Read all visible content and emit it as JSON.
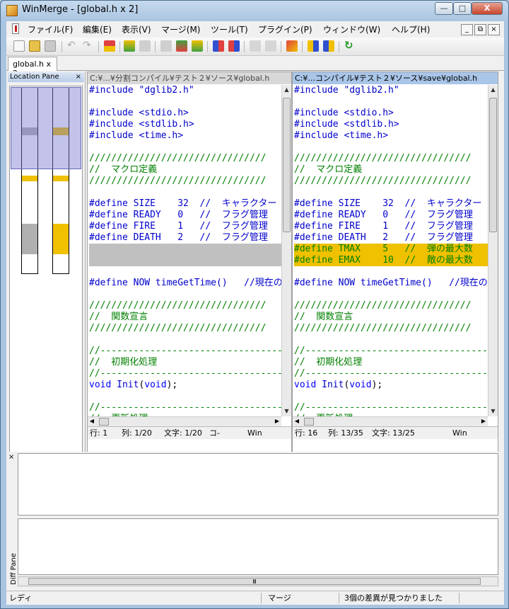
{
  "window": {
    "title": "WinMerge - [global.h x 2]",
    "min_icon": "minimize-icon",
    "max_icon": "maximize-icon",
    "close_icon": "close-icon",
    "close_glyph": "X"
  },
  "menu": {
    "items": [
      "ファイル(F)",
      "編集(E)",
      "表示(V)",
      "マージ(M)",
      "ツール(T)",
      "プラグイン(P)",
      "ウィンドウ(W)",
      "ヘルプ(H)"
    ]
  },
  "tab": {
    "label": "global.h x 2"
  },
  "location_pane": {
    "title": "Location Pane",
    "close": "×"
  },
  "left_pane": {
    "path": "C:¥...¥分割コンパイル¥テスト２¥ソース¥global.h",
    "status": {
      "line": "行: 1",
      "col": "列: 1/20",
      "char": "文字: 1/20",
      "cp": "コ-",
      "eol": "Win"
    }
  },
  "right_pane": {
    "path": "C:¥...コンパイル¥テスト２¥ソース¥save¥global.h",
    "status": {
      "line": "行: 16",
      "col": "列: 13/35",
      "char": "文字: 13/25",
      "eol": "Win"
    }
  },
  "code": {
    "left": [
      {
        "t": "#include \"dglib2.h\"",
        "c": "pp"
      },
      {
        "t": "",
        "c": "blk"
      },
      {
        "t": "#include <stdio.h>",
        "c": "pp"
      },
      {
        "t": "#include <stdlib.h>",
        "c": "pp"
      },
      {
        "t": "#include <time.h>",
        "c": "pp"
      },
      {
        "t": "",
        "c": "blk"
      },
      {
        "t": "////////////////////////////////",
        "c": ""
      },
      {
        "t": "//  マクロ定義",
        "c": ""
      },
      {
        "t": "////////////////////////////////",
        "c": ""
      },
      {
        "t": "",
        "c": "blk"
      },
      {
        "t": "#define SIZE    32  //  キャラクター",
        "c": "pp"
      },
      {
        "t": "#define READY   0   //  フラグ管理",
        "c": "pp"
      },
      {
        "t": "#define FIRE    1   //  フラグ管理",
        "c": "pp"
      },
      {
        "t": "#define DEATH   2   //  フラグ管理",
        "c": "pp"
      },
      {
        "t": "",
        "c": "gap"
      },
      {
        "t": "",
        "c": "gap"
      },
      {
        "t": "",
        "c": "blk"
      },
      {
        "t": "#define NOW timeGetTime()   //現在の",
        "c": "pp"
      },
      {
        "t": "",
        "c": "blk"
      },
      {
        "t": "////////////////////////////////",
        "c": ""
      },
      {
        "t": "//  関数宣言",
        "c": ""
      },
      {
        "t": "////////////////////////////////",
        "c": ""
      },
      {
        "t": "",
        "c": "blk"
      },
      {
        "t": "//--------------------------------------",
        "c": ""
      },
      {
        "t": "//  初期化処理",
        "c": ""
      },
      {
        "t": "//--------------------------------------",
        "c": ""
      },
      {
        "t": "void Init(void);",
        "c": "fn"
      },
      {
        "t": "",
        "c": "blk"
      },
      {
        "t": "//--------------------------------------",
        "c": ""
      },
      {
        "t": "//  更新処理",
        "c": ""
      }
    ],
    "right": [
      {
        "t": "#include \"dglib2.h\"",
        "c": "pp"
      },
      {
        "t": "",
        "c": "blk"
      },
      {
        "t": "#include <stdio.h>",
        "c": "pp"
      },
      {
        "t": "#include <stdlib.h>",
        "c": "pp"
      },
      {
        "t": "#include <time.h>",
        "c": "pp"
      },
      {
        "t": "",
        "c": "blk"
      },
      {
        "t": "////////////////////////////////",
        "c": ""
      },
      {
        "t": "//  マクロ定義",
        "c": ""
      },
      {
        "t": "////////////////////////////////",
        "c": ""
      },
      {
        "t": "",
        "c": "blk"
      },
      {
        "t": "#define SIZE    32  //  キャラクター",
        "c": "pp"
      },
      {
        "t": "#define READY   0   //  フラグ管理",
        "c": "pp"
      },
      {
        "t": "#define FIRE    1   //  フラグ管理",
        "c": "pp"
      },
      {
        "t": "#define DEATH   2   //  フラグ管理",
        "c": "pp"
      },
      {
        "t": "#define TMAX    5   //  弾の最大数",
        "c": "hl"
      },
      {
        "t": "#define EMAX    10  //  敵の最大数",
        "c": "hl"
      },
      {
        "t": "",
        "c": "blk"
      },
      {
        "t": "#define NOW timeGetTime()   //現在の",
        "c": "pp"
      },
      {
        "t": "",
        "c": "blk"
      },
      {
        "t": "////////////////////////////////",
        "c": ""
      },
      {
        "t": "//  関数宣言",
        "c": ""
      },
      {
        "t": "////////////////////////////////",
        "c": ""
      },
      {
        "t": "",
        "c": "blk"
      },
      {
        "t": "//--------------------------------------",
        "c": ""
      },
      {
        "t": "//  初期化処理",
        "c": ""
      },
      {
        "t": "//--------------------------------------",
        "c": ""
      },
      {
        "t": "void Init(void);",
        "c": "fn"
      },
      {
        "t": "",
        "c": "blk"
      },
      {
        "t": "//--------------------------------------",
        "c": ""
      },
      {
        "t": "//  更新処理",
        "c": ""
      }
    ]
  },
  "diff_pane": {
    "label": "Diff Pane",
    "close": "×",
    "scroll_grip": "Ⅲ"
  },
  "statusbar": {
    "ready": "レディ",
    "mode": "マージ",
    "diffs": "3個の差異が見つかりました"
  },
  "colors": {
    "diff_yellow": "#efc100",
    "diff_gray": "#c0c0c0",
    "comment": "#008000",
    "preproc": "#0000cc"
  }
}
